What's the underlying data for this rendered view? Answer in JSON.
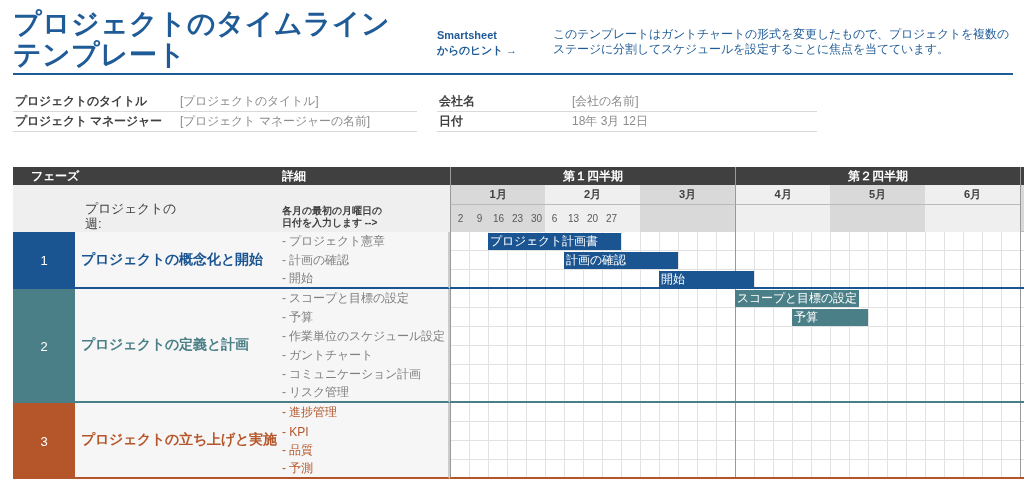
{
  "header": {
    "title_lines": [
      "プロジェクトのタイムライン",
      "テンプレート"
    ],
    "hint_lines": [
      "Smartsheet",
      "からのヒント →"
    ],
    "description": "このテンプレートはガントチャートの形式を変更したもので、プロジェクトを複数のステージに分割してスケジュールを設定することに焦点を当てています。"
  },
  "info": {
    "left": [
      {
        "label": "プロジェクトのタイトル",
        "value": "[プロジェクトのタイトル]"
      },
      {
        "label": "プロジェクト マネージャー",
        "value": "[プロジェクト マネージャーの名前]"
      }
    ],
    "right": [
      {
        "label": "会社名",
        "value": "[会社の名前]"
      },
      {
        "label": "日付",
        "value": "18年 3月 12日"
      }
    ]
  },
  "table": {
    "phase_heading": "フェーズ",
    "detail_heading": "詳細",
    "weeks_label": "プロジェクトの週:",
    "weeks_hint": "各月の最初の月曜日の日付を入力します -->",
    "quarters": [
      {
        "label": "第１四半期",
        "months": [
          {
            "label": "1月",
            "weeks": [
              "2",
              "9",
              "16",
              "23",
              "30"
            ]
          },
          {
            "label": "2月",
            "weeks": [
              "6",
              "13",
              "20",
              "27"
            ]
          },
          {
            "label": "3月"
          }
        ]
      },
      {
        "label": "第２四半期",
        "months": [
          {
            "label": "4月"
          },
          {
            "label": "5月"
          },
          {
            "label": "6月"
          }
        ]
      }
    ],
    "phases": [
      {
        "number": "1",
        "name": "プロジェクトの概念化と開始",
        "color": "#1a5592",
        "tasks": [
          {
            "detail": "- プロジェクト憲章",
            "bar": {
              "label": "プロジェクト計画書"
            }
          },
          {
            "detail": "- 計画の確認",
            "bar": {
              "label": "計画の確認"
            }
          },
          {
            "detail": "- 開始",
            "bar": {
              "label": "開始"
            }
          }
        ]
      },
      {
        "number": "2",
        "name": "プロジェクトの定義と計画",
        "color": "#4a7f87",
        "tasks": [
          {
            "detail": "- スコープと目標の設定",
            "bar": {
              "label": "スコープと目標の設定"
            }
          },
          {
            "detail": "- 予算",
            "bar": {
              "label": "予算"
            }
          },
          {
            "detail": "- 作業単位のスケジュール設定"
          },
          {
            "detail": "- ガントチャート"
          },
          {
            "detail": "- コミュニケーション計画"
          },
          {
            "detail": "- リスク管理"
          }
        ]
      },
      {
        "number": "3",
        "name": "プロジェクトの立ち上げと実施",
        "color": "#b5562a",
        "tasks": [
          {
            "detail": "- 進捗管理"
          },
          {
            "detail": "- KPI"
          },
          {
            "detail": "- 品質"
          },
          {
            "detail": "- 予測"
          }
        ]
      }
    ]
  }
}
